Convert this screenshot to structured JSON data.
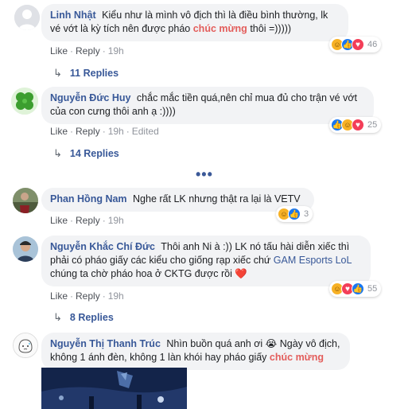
{
  "comments": [
    {
      "author": "Linh Nhật",
      "text_before": "Kiểu như là mình vô địch thì là điều bình thường, lk vé vớt là kỳ tích nên được pháo",
      "highlight": "chúc mừng",
      "text_after": "thôi =)))))",
      "like": "Like",
      "reply": "Reply",
      "time": "19h",
      "reaction_count": "46",
      "replies_label": "11 Replies"
    },
    {
      "author": "Nguyễn Đức Huy",
      "text": "chắc mắc tiền quá,nên chỉ mua đủ cho trận vé vớt của con cưng thôi anh ạ :))))",
      "like": "Like",
      "reply": "Reply",
      "time": "19h",
      "edited": "Edited",
      "reaction_count": "25",
      "replies_label": "14 Replies"
    },
    {
      "author": "Phan Hồng Nam",
      "text": "Nghe rất LK nhưng thật ra lại là VETV",
      "like": "Like",
      "reply": "Reply",
      "time": "19h",
      "reaction_count": "3"
    },
    {
      "author": "Nguyễn Khắc Chí Đức",
      "text_before": "Thôi anh Ni à :)) LK nó tấu hài diễn xiếc thì phải có pháo giấy các kiểu cho giống rạp xiếc chứ",
      "tag": "GAM Esports LoL",
      "text_after": "chúng ta chờ pháo hoa ở CKTG được rồi ❤️",
      "like": "Like",
      "reply": "Reply",
      "time": "19h",
      "reaction_count": "55",
      "replies_label": "8 Replies"
    },
    {
      "author": "Nguyễn Thị Thanh Trúc",
      "text_before": "Nhìn buồn quá anh ơi 😭 Ngày vô địch, không 1 ánh đèn, không 1 làn khói hay pháo giấy",
      "highlight": "chúc mừng"
    }
  ],
  "more_label": "•••",
  "colors": {
    "author": "#385898",
    "highlight": "#e35d5b",
    "bubble": "#f2f3f5",
    "like": "#1877f2",
    "love": "#f33e58",
    "haha": "#f7b125"
  },
  "icons": [
    "default-avatar-icon",
    "clover-avatar-icon",
    "haha-reaction-icon",
    "like-reaction-icon",
    "love-reaction-icon",
    "reply-arrow-icon",
    "more-dots-icon"
  ]
}
